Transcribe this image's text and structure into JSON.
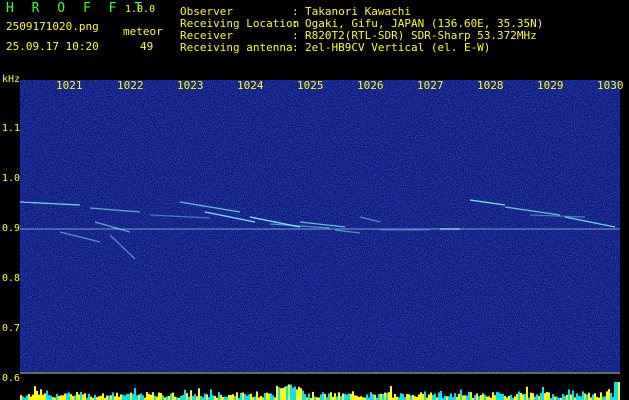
{
  "app": {
    "title": "H R O F F T",
    "version": "1.0.0"
  },
  "file": {
    "name": "2509171020.png",
    "datetime": "25.09.17 10:20"
  },
  "meteor": {
    "label": "meteor",
    "count": "49"
  },
  "info": [
    {
      "key": "Observer",
      "value": "Takanori Kawachi"
    },
    {
      "key": "Receiving Location",
      "value": "Ogaki, Gifu, JAPAN (136.60E, 35.35N)"
    },
    {
      "key": "Receiver",
      "value": "R820T2(RTL-SDR) SDR-Sharp 53.372MHz"
    },
    {
      "key": "Receiving antenna",
      "value": "2el-HB9CV Vertical (el. E-W)"
    }
  ],
  "axis": {
    "unit": "kHz",
    "y_ticks": [
      "1.1",
      "1.0",
      "0.9",
      "0.8",
      "0.7",
      "0.6"
    ],
    "x_ticks": [
      "1021",
      "1022",
      "1023",
      "1024",
      "1025",
      "1026",
      "1027",
      "1028",
      "1029",
      "1030"
    ]
  },
  "colors": {
    "background": "#000000",
    "spectrogram": "#0a1a8c",
    "echo": "#7fffff",
    "text": "#ffff00",
    "title": "#32ff32",
    "level": "#00e5ff"
  }
}
